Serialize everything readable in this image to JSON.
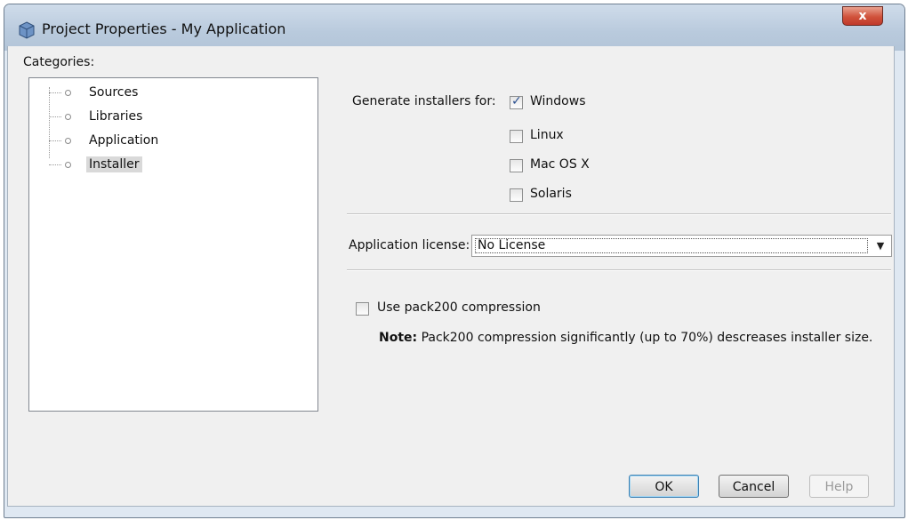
{
  "window": {
    "title": "Project Properties - My Application",
    "close_label": "x"
  },
  "categories": {
    "label": "Categories:",
    "items": [
      {
        "label": "Sources",
        "selected": false
      },
      {
        "label": "Libraries",
        "selected": false
      },
      {
        "label": "Application",
        "selected": false
      },
      {
        "label": "Installer",
        "selected": true
      }
    ]
  },
  "installers": {
    "label": "Generate installers for:",
    "options": [
      {
        "label": "Windows",
        "checked": true
      },
      {
        "label": "Linux",
        "checked": false
      },
      {
        "label": "Mac OS X",
        "checked": false
      },
      {
        "label": "Solaris",
        "checked": false
      }
    ]
  },
  "license": {
    "label": "Application license:",
    "value": "No License"
  },
  "compression": {
    "label": "Use pack200 compression",
    "checked": false,
    "note_bold": "Note:",
    "note_text": " Pack200 compression significantly (up to 70%) descreases installer size."
  },
  "buttons": {
    "ok": "OK",
    "cancel": "Cancel",
    "help": "Help"
  }
}
